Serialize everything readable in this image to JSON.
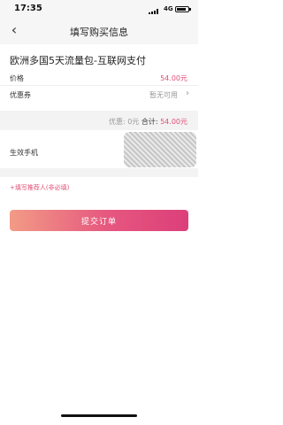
{
  "status_bar": {
    "time": "17:35",
    "network": "4G"
  },
  "nav": {
    "title": "填写购买信息",
    "back_icon": "chevron-left-icon"
  },
  "product": {
    "name": "欧洲多国5天流量包-互联网支付"
  },
  "price": {
    "label": "价格",
    "value": "54.00元"
  },
  "coupon": {
    "label": "优惠券",
    "value": "暂无可用"
  },
  "summary": {
    "discount": "优惠: 0元",
    "total_label": "合计:",
    "total_value": "54.00元"
  },
  "phone": {
    "label": "生效手机"
  },
  "referrer": {
    "label": "+填写推荐人(非必填)"
  },
  "submit": {
    "label": "提交订单"
  },
  "colors": {
    "accent": "#e24f76",
    "button_start": "#f29b86",
    "button_end": "#dc3f7a"
  }
}
